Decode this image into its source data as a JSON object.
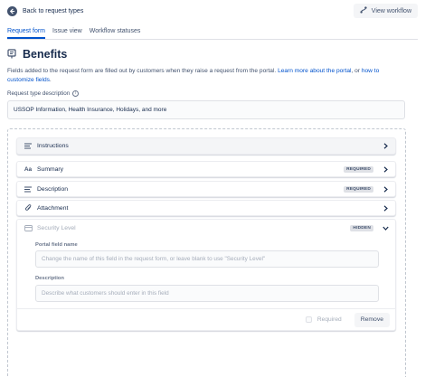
{
  "topbar": {
    "back_label": "Back to request types",
    "back_icon": "arrow-left-icon",
    "view_workflow_label": "View workflow",
    "view_workflow_icon": "workflow-icon"
  },
  "tabs": [
    {
      "label": "Request form",
      "active": true
    },
    {
      "label": "Issue view",
      "active": false
    },
    {
      "label": "Workflow statuses",
      "active": false
    }
  ],
  "page": {
    "title": "Benefits",
    "title_icon": "request-type-icon"
  },
  "description": {
    "text": "Fields added to the request form are filled out by customers when they raise a request from the portal. ",
    "link1": "Learn more about the portal",
    "middle": ", or ",
    "link2": "how to customize fields",
    "end": "."
  },
  "request_type_description": {
    "label": "Request type description",
    "value": "USSOP Information, Health Insurance, Holidays, and more"
  },
  "fields": [
    {
      "label": "Instructions",
      "icon": "text-lines-icon",
      "badge": ""
    },
    {
      "label": "Summary",
      "icon": "text-format-icon",
      "badge": "REQUIRED"
    },
    {
      "label": "Description",
      "icon": "text-lines-icon",
      "badge": "REQUIRED"
    },
    {
      "label": "Attachment",
      "icon": "paperclip-icon",
      "badge": ""
    }
  ],
  "security_level": {
    "label": "Security Level",
    "icon": "security-card-icon",
    "badge": "HIDDEN",
    "portal_field_name_label": "Portal field name",
    "portal_field_name_placeholder": "Change the name of this field in the request form, or leave blank to use \"Security Level\"",
    "description_label": "Description",
    "description_placeholder": "Describe what customers should enter in this field",
    "required_label": "Required",
    "remove_label": "Remove"
  },
  "colors": {
    "accent": "#0052cc",
    "text": "#172b4d",
    "subtle": "#42526e",
    "border": "#dfe1e6"
  }
}
